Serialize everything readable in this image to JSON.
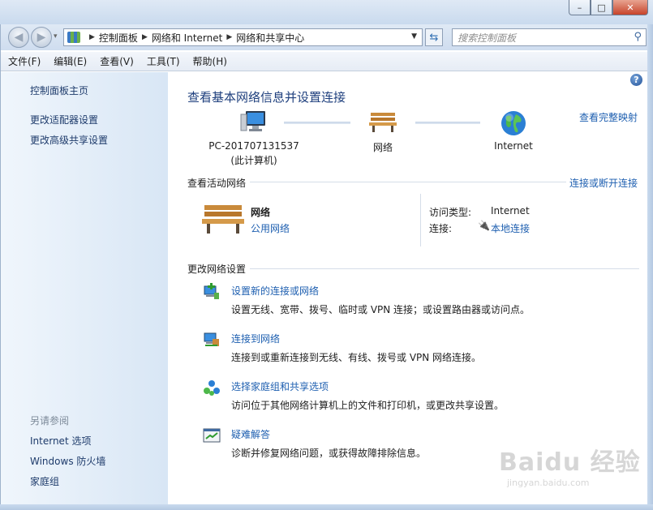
{
  "window": {
    "min": "–",
    "max": "□",
    "close": "✕"
  },
  "nav": {
    "breadcrumbs": [
      "控制面板",
      "网络和 Internet",
      "网络和共享中心"
    ],
    "search_placeholder": "搜索控制面板"
  },
  "menu": [
    "文件(F)",
    "编辑(E)",
    "查看(V)",
    "工具(T)",
    "帮助(H)"
  ],
  "sidebar": {
    "links": [
      "控制面板主页",
      "更改适配器设置",
      "更改高级共享设置"
    ],
    "see_also_title": "另请参阅",
    "see_also": [
      "Internet 选项",
      "Windows 防火墙",
      "家庭组"
    ]
  },
  "main": {
    "title": "查看基本网络信息并设置连接",
    "full_map_link": "查看完整映射",
    "map": {
      "computer_name": "PC-201707131537",
      "computer_sub": "(此计算机)",
      "network": "网络",
      "internet": "Internet"
    },
    "active": {
      "heading": "查看活动网络",
      "connect_link": "连接或断开连接",
      "network_name": "网络",
      "network_type_link": "公用网络",
      "access_label": "访问类型:",
      "access_value": "Internet",
      "conn_label": "连接:",
      "conn_value": "本地连接"
    },
    "change": {
      "heading": "更改网络设置",
      "tasks": [
        {
          "link": "设置新的连接或网络",
          "desc": "设置无线、宽带、拨号、临时或 VPN 连接；或设置路由器或访问点。",
          "icon": "new-connection-icon"
        },
        {
          "link": "连接到网络",
          "desc": "连接到或重新连接到无线、有线、拨号或 VPN 网络连接。",
          "icon": "connect-network-icon"
        },
        {
          "link": "选择家庭组和共享选项",
          "desc": "访问位于其他网络计算机上的文件和打印机，或更改共享设置。",
          "icon": "homegroup-icon"
        },
        {
          "link": "疑难解答",
          "desc": "诊断并修复网络问题，或获得故障排除信息。",
          "icon": "troubleshoot-icon"
        }
      ]
    }
  },
  "watermark": {
    "main": "Baidu 经验",
    "sub": "jingyan.baidu.com"
  },
  "colors": {
    "link": "#1e5fb0",
    "title": "#1e3f7d",
    "sidebar_link": "#1e3b6b"
  }
}
